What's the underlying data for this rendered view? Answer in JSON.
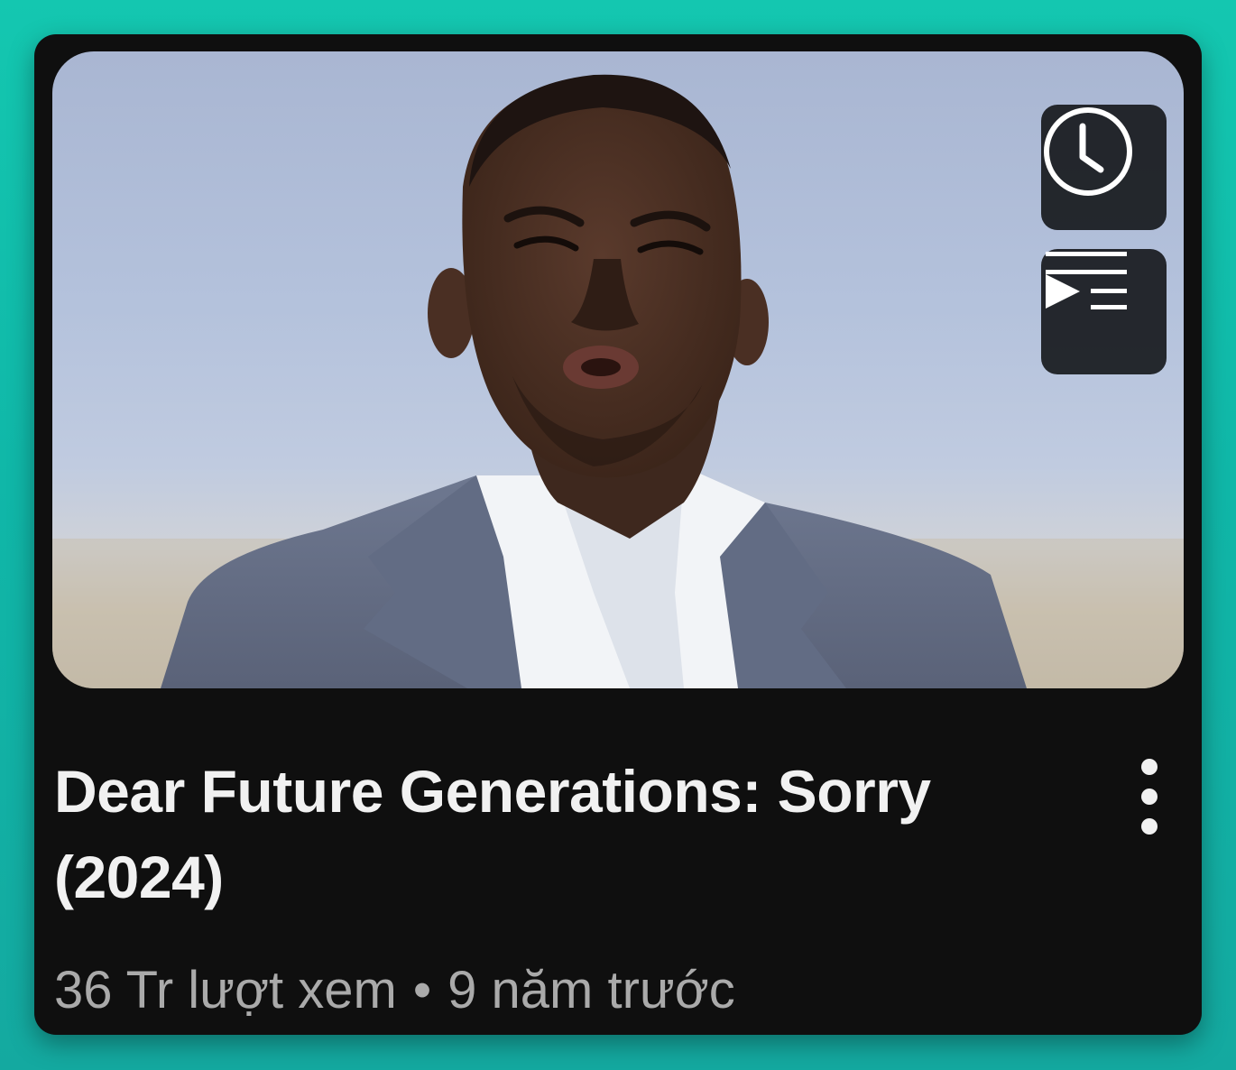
{
  "video": {
    "title": "Dear Future Generations: Sorry (2024)",
    "views": "36 Tr lượt xem",
    "separator": "•",
    "age": "9 năm trước"
  },
  "thumbnail": {
    "subject": "man in grey suit and white shirt, outdoors, sky background"
  },
  "overlay_buttons": [
    {
      "name": "watch-later",
      "icon": "clock-icon"
    },
    {
      "name": "add-to-queue",
      "icon": "queue-play-icon"
    }
  ],
  "menu": {
    "icon": "more-vert-icon"
  },
  "colors": {
    "background": "#12bfac",
    "card": "#0f0f0f",
    "title_text": "#f1f1f1",
    "meta_text": "#aaaaaa",
    "overlay_button": "#14161a"
  }
}
